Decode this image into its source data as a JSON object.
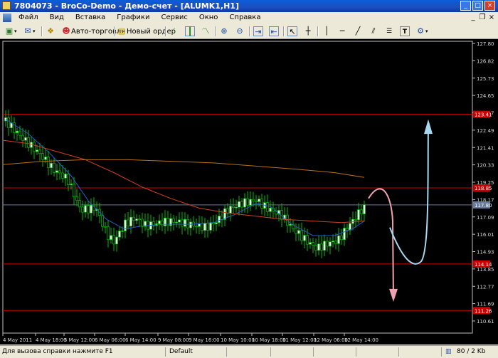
{
  "window": {
    "title": "7804073 - BroCo-Demo - Демо-счет - [ALUMK1,H1]"
  },
  "menu": {
    "items": [
      "Файл",
      "Вид",
      "Вставка",
      "Графики",
      "Сервис",
      "Окно",
      "Справка"
    ]
  },
  "toolbar": {
    "autotrade_label": "Авто-торговля",
    "new_order_label": "Новый ордер"
  },
  "chart_data": {
    "type": "candlestick",
    "symbol": "ALUMK1",
    "timeframe": "H1",
    "ylim": [
      110.0,
      128.0
    ],
    "y_ticks": [
      "127.80",
      "126.82",
      "125.73",
      "124.65",
      "123.57",
      "122.49",
      "121.41",
      "120.33",
      "119.25",
      "118.17",
      "117.09",
      "116.01",
      "114.93",
      "113.85",
      "112.77",
      "111.69",
      "110.61"
    ],
    "x_ticks": [
      "4 May 2011",
      "4 May 18:00",
      "5 May 12:00",
      "6 May 06:00",
      "6 May 14:00",
      "9 May 08:00",
      "9 May 16:00",
      "10 May 10:00",
      "10 May 18:00",
      "11 May 12:00",
      "12 May 06:00",
      "12 May 14:00"
    ],
    "horizontal_levels": [
      {
        "label": "123.41",
        "value": 123.41,
        "color": "#cc0000"
      },
      {
        "label": "118.85",
        "value": 118.85,
        "color": "#cc0000"
      },
      {
        "label": "117.80",
        "value": 117.8,
        "color": "#6a7aa0"
      },
      {
        "label": "114.14",
        "value": 114.14,
        "color": "#cc0000"
      },
      {
        "label": "111.26",
        "value": 111.26,
        "color": "#cc0000"
      }
    ],
    "candle_colors": {
      "bull": "#00c000",
      "bear": "#00c000",
      "body_bear": "#000000",
      "body_bull": "#ffffff"
    },
    "ma_colors": [
      "#2060d0",
      "#d04020",
      "#b87018"
    ],
    "arrow_up_color": "#a8d8f0",
    "arrow_down_color": "#f0a0b0"
  },
  "status": {
    "help": "Для вызова справки нажмите F1",
    "profile": "Default",
    "traffic": "80 / 2 Kb"
  }
}
